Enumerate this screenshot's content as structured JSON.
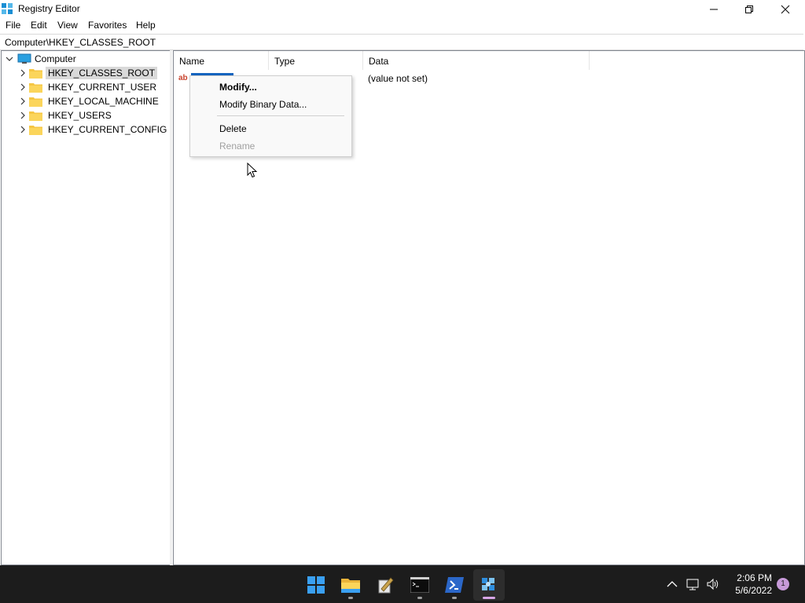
{
  "window": {
    "title": "Registry Editor"
  },
  "menu": [
    "File",
    "Edit",
    "View",
    "Favorites",
    "Help"
  ],
  "address": "Computer\\HKEY_CLASSES_ROOT",
  "tree": {
    "root": "Computer",
    "items": [
      {
        "label": "HKEY_CLASSES_ROOT",
        "selected": true
      },
      {
        "label": "HKEY_CURRENT_USER",
        "selected": false
      },
      {
        "label": "HKEY_LOCAL_MACHINE",
        "selected": false
      },
      {
        "label": "HKEY_USERS",
        "selected": false
      },
      {
        "label": "HKEY_CURRENT_CONFIG",
        "selected": false
      }
    ]
  },
  "list": {
    "columns": [
      "Name",
      "Type",
      "Data"
    ],
    "rows": [
      {
        "icon": "ab",
        "data": "(value not set)"
      }
    ]
  },
  "context_menu": {
    "items": [
      {
        "label": "Modify...",
        "default": true,
        "enabled": true
      },
      {
        "label": "Modify Binary Data...",
        "default": false,
        "enabled": true
      },
      {
        "label": "Delete",
        "default": false,
        "enabled": true
      },
      {
        "label": "Rename",
        "default": false,
        "enabled": false
      }
    ]
  },
  "taskbar": {
    "apps": [
      "start-icon",
      "file-explorer-icon",
      "notepad-icon",
      "command-prompt-icon",
      "powershell-icon",
      "registry-editor-icon"
    ],
    "active_app": "registry-editor-icon",
    "time": "2:06 PM",
    "date": "5/6/2022",
    "notification_count": "1"
  },
  "colors": {
    "selection": "#1565c0",
    "taskbar": "#1c1c1c",
    "tree_selection": "#d9d9d9"
  }
}
